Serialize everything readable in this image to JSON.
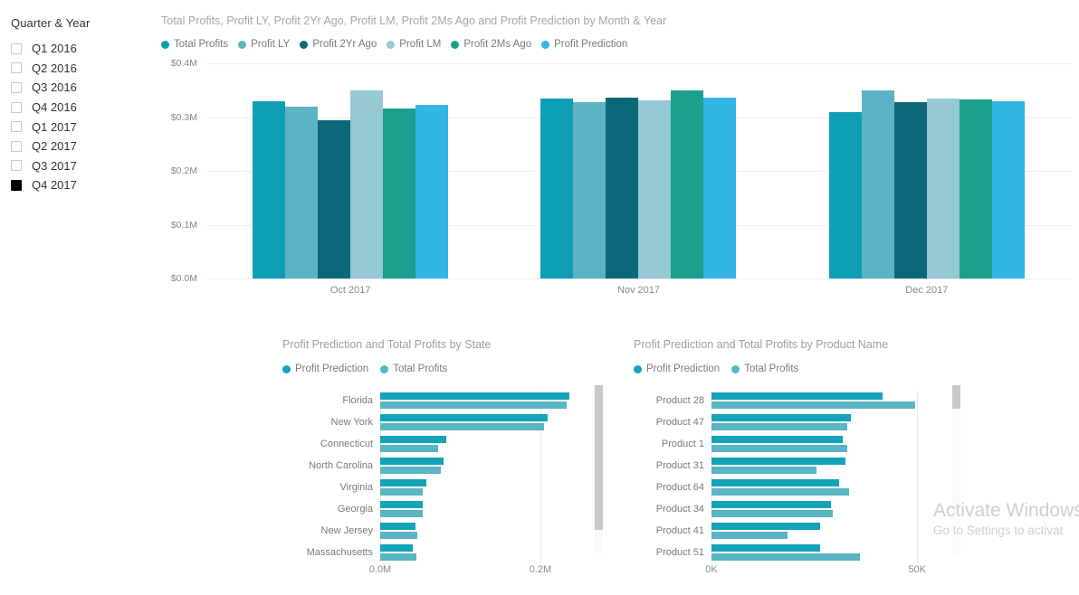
{
  "slicer": {
    "title": "Quarter & Year",
    "items": [
      {
        "label": "Q1 2016",
        "checked": false
      },
      {
        "label": "Q2 2016",
        "checked": false
      },
      {
        "label": "Q3 2016",
        "checked": false
      },
      {
        "label": "Q4 2016",
        "checked": false
      },
      {
        "label": "Q1 2017",
        "checked": false
      },
      {
        "label": "Q2 2017",
        "checked": false
      },
      {
        "label": "Q3 2017",
        "checked": false
      },
      {
        "label": "Q4 2017",
        "checked": true
      }
    ]
  },
  "watermark": {
    "line1": "Activate Windows",
    "line2": "Go to Settings to activat"
  },
  "colors": {
    "total_profits": "#0f9fb5",
    "profit_ly": "#5cb3c4",
    "profit_2yr_ago": "#0c6878",
    "profit_lm": "#96c9d3",
    "profit_2ms_ago": "#1aa08d",
    "profit_prediction": "#33b5e5",
    "bar_pred": "#14a3b8",
    "bar_total": "#59b5c4",
    "gridline": "#eeeeee",
    "text_muted": "#888888",
    "title_muted": "#a6a6a6"
  },
  "chart_data": [
    {
      "id": "main_column_chart",
      "type": "bar",
      "title": "Total Profits, Profit LY, Profit 2Yr Ago, Profit LM, Profit 2Ms Ago and Profit Prediction by Month & Year",
      "xlabel": "",
      "ylabel": "",
      "categories": [
        "Oct 2017",
        "Nov 2017",
        "Dec 2017"
      ],
      "ylim": [
        0,
        0.4
      ],
      "ytick_labels": [
        "$0.4M",
        "$0.3M",
        "$0.2M",
        "$0.1M",
        "$0.0M"
      ],
      "ytick_values": [
        0.4,
        0.3,
        0.2,
        0.1,
        0.0
      ],
      "grid": true,
      "legend_position": "top",
      "series": [
        {
          "name": "Total Profits",
          "color": "#0f9fb5",
          "values": [
            0.33,
            0.335,
            0.31
          ]
        },
        {
          "name": "Profit LY",
          "color": "#5cb3c4",
          "values": [
            0.32,
            0.327,
            0.35
          ]
        },
        {
          "name": "Profit 2Yr Ago",
          "color": "#0c6878",
          "values": [
            0.294,
            0.337,
            0.327
          ]
        },
        {
          "name": "Profit LM",
          "color": "#96c9d3",
          "values": [
            0.35,
            0.331,
            0.334
          ]
        },
        {
          "name": "Profit 2Ms Ago",
          "color": "#1aa08d",
          "values": [
            0.316,
            0.35,
            0.333
          ]
        },
        {
          "name": "Profit Prediction",
          "color": "#33b5e5",
          "values": [
            0.322,
            0.336,
            0.33
          ]
        }
      ]
    },
    {
      "id": "state_bar_chart",
      "type": "bar",
      "orientation": "horizontal",
      "title": "Profit Prediction and Total Profits by State",
      "xlabel": "",
      "ylabel": "",
      "categories": [
        "Florida",
        "New York",
        "Connecticut",
        "North Carolina",
        "Virginia",
        "Georgia",
        "New Jersey",
        "Massachusetts"
      ],
      "xlim": [
        0,
        0.26
      ],
      "xtick_labels": [
        "0.0M",
        "0.2M"
      ],
      "xtick_values": [
        0.0,
        0.2
      ],
      "legend_position": "top",
      "series": [
        {
          "name": "Profit Prediction",
          "color": "#14a3b8",
          "values": [
            0.236,
            0.209,
            0.083,
            0.079,
            0.058,
            0.053,
            0.044,
            0.041
          ]
        },
        {
          "name": "Total Profits",
          "color": "#59b5c4",
          "values": [
            0.233,
            0.205,
            0.072,
            0.076,
            0.053,
            0.053,
            0.046,
            0.045
          ]
        }
      ]
    },
    {
      "id": "product_bar_chart",
      "type": "bar",
      "orientation": "horizontal",
      "title": "Profit Prediction and Total Profits by Product Name",
      "xlabel": "",
      "ylabel": "",
      "categories": [
        "Product 28",
        "Product 47",
        "Product 1",
        "Product 31",
        "Product 64",
        "Product 34",
        "Product 41",
        "Product 51"
      ],
      "xlim": [
        0,
        57
      ],
      "xtick_labels": [
        "0K",
        "50K"
      ],
      "xtick_values": [
        0,
        50
      ],
      "legend_position": "top",
      "series": [
        {
          "name": "Profit Prediction",
          "color": "#14a3b8",
          "values": [
            41.5,
            34.0,
            32.0,
            32.5,
            31.0,
            29.0,
            26.5,
            26.5
          ]
        },
        {
          "name": "Total Profits",
          "color": "#59b5c4",
          "values": [
            49.5,
            33.0,
            33.0,
            25.5,
            33.5,
            29.5,
            18.5,
            36.0
          ]
        }
      ]
    }
  ]
}
